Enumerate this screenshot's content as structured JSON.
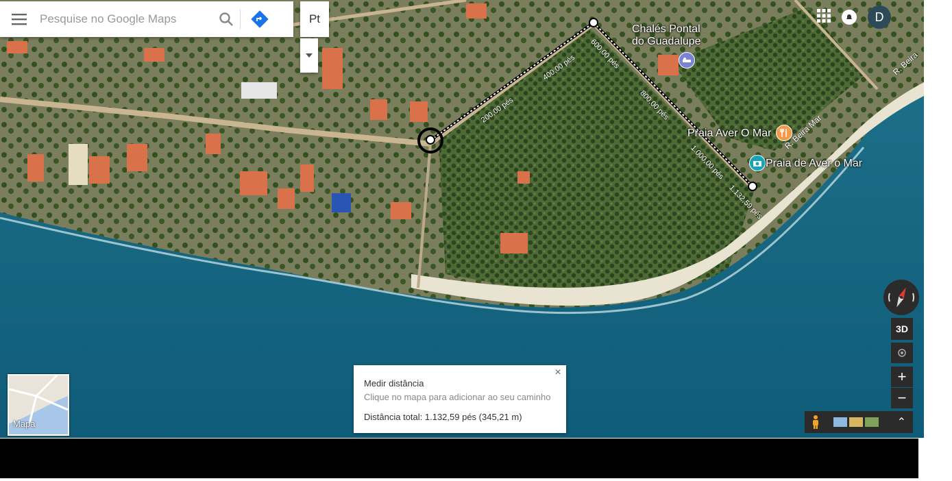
{
  "search": {
    "placeholder": "Pesquise no Google Maps"
  },
  "lang": {
    "label": "Pt"
  },
  "account": {
    "initial": "D"
  },
  "places": [
    {
      "name_line1": "Chalés Pontal",
      "name_line2": "do Guadalupe",
      "icon": "hotel-icon"
    },
    {
      "name": "Praia Aver O Mar",
      "icon": "restaurant-icon"
    },
    {
      "name": "Praia de Aver o Mar",
      "icon": "camera-icon"
    }
  ],
  "streets": [
    "R. Beira Mar",
    "R. Beira"
  ],
  "measure_labels": [
    "200,00 pés",
    "400,00 pés",
    "600,00 pés",
    "800,00 pés",
    "1.000,00 pés",
    "1.132,59 pés"
  ],
  "measure_box": {
    "title": "Medir distância",
    "hint": "Clique no mapa para adicionar ao seu caminho",
    "total": "Distância total: 1.132,59 pés (345,21 m)",
    "close": "×"
  },
  "thumbnail": {
    "label": "Mapa"
  },
  "controls": {
    "three_d": "3D",
    "zoom_in": "+",
    "zoom_out": "−",
    "expand": "⌃"
  },
  "colors": {
    "water": "#1c6a86",
    "shore": "#e9e3d1",
    "vegetation": "#3d5b2e",
    "accent": "#1a73e8"
  }
}
